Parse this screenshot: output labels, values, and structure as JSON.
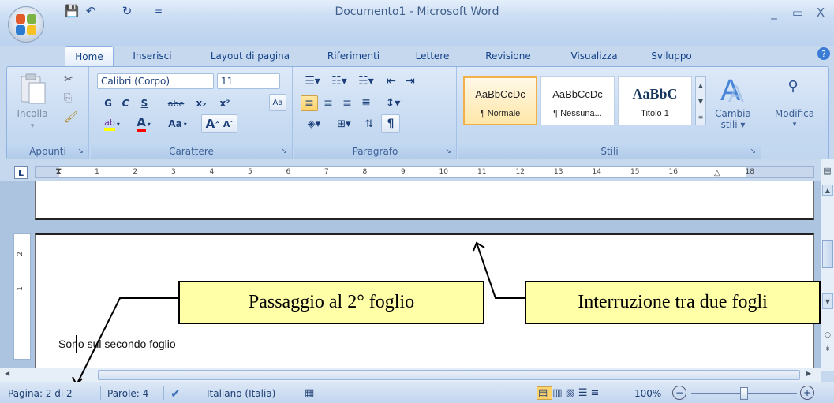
{
  "window": {
    "title": "Documento1 - Microsoft Word",
    "minimize": "_",
    "maximize": "▭",
    "close": "X"
  },
  "quick_access": {
    "save": "💾",
    "undo": "↶",
    "redo": "↻",
    "customize": "="
  },
  "tabs": [
    "Home",
    "Inserisci",
    "Layout di pagina",
    "Riferimenti",
    "Lettere",
    "Revisione",
    "Visualizza",
    "Sviluppo"
  ],
  "help": "?",
  "ribbon": {
    "clipboard": {
      "label": "Appunti",
      "paste": "Incolla",
      "paste_arrow": "▾"
    },
    "font": {
      "label": "Carattere",
      "font_name": "Calibri (Corpo)",
      "font_size": "11",
      "bold": "G",
      "italic": "C",
      "underline": "S",
      "strike": "abe",
      "subscript": "x₂",
      "superscript": "x²",
      "change_case": "Aa",
      "grow": "A",
      "shrink": "A"
    },
    "paragraph": {
      "label": "Paragrafo",
      "pilcrow": "¶"
    },
    "styles": {
      "label": "Stili",
      "items": [
        {
          "sample": "AaBbCcDc",
          "name": "¶ Normale"
        },
        {
          "sample": "AaBbCcDc",
          "name": "¶ Nessuna..."
        },
        {
          "sample": "AaBbC",
          "name": "Titolo 1"
        }
      ],
      "change_styles": "Cambia",
      "change_styles_2": "stili ▾"
    },
    "editing": {
      "label": "Modifica",
      "arrow": "▾"
    }
  },
  "ruler": {
    "tab_selector": "L",
    "numbers": [
      "1",
      "2",
      "3",
      "4",
      "5",
      "6",
      "7",
      "8",
      "9",
      "10",
      "11",
      "12",
      "13",
      "14",
      "15",
      "16",
      "18"
    ],
    "vertical_numbers": [
      "2",
      "1"
    ]
  },
  "document": {
    "body_text": "Sono sul secondo foglio"
  },
  "callouts": {
    "sheet_change": "Passaggio al 2° foglio",
    "page_break": "Interruzione tra due fogli"
  },
  "status": {
    "page": "Pagina: 2 di 2",
    "words": "Parole: 4",
    "language": "Italiano (Italia)",
    "zoom": "100%",
    "zoom_minus": "−",
    "zoom_plus": "+",
    "zoom_level": 0.5
  },
  "colors": {
    "highlight": "#ffff00",
    "font_color": "#ff0000",
    "accent": "#15428b"
  }
}
